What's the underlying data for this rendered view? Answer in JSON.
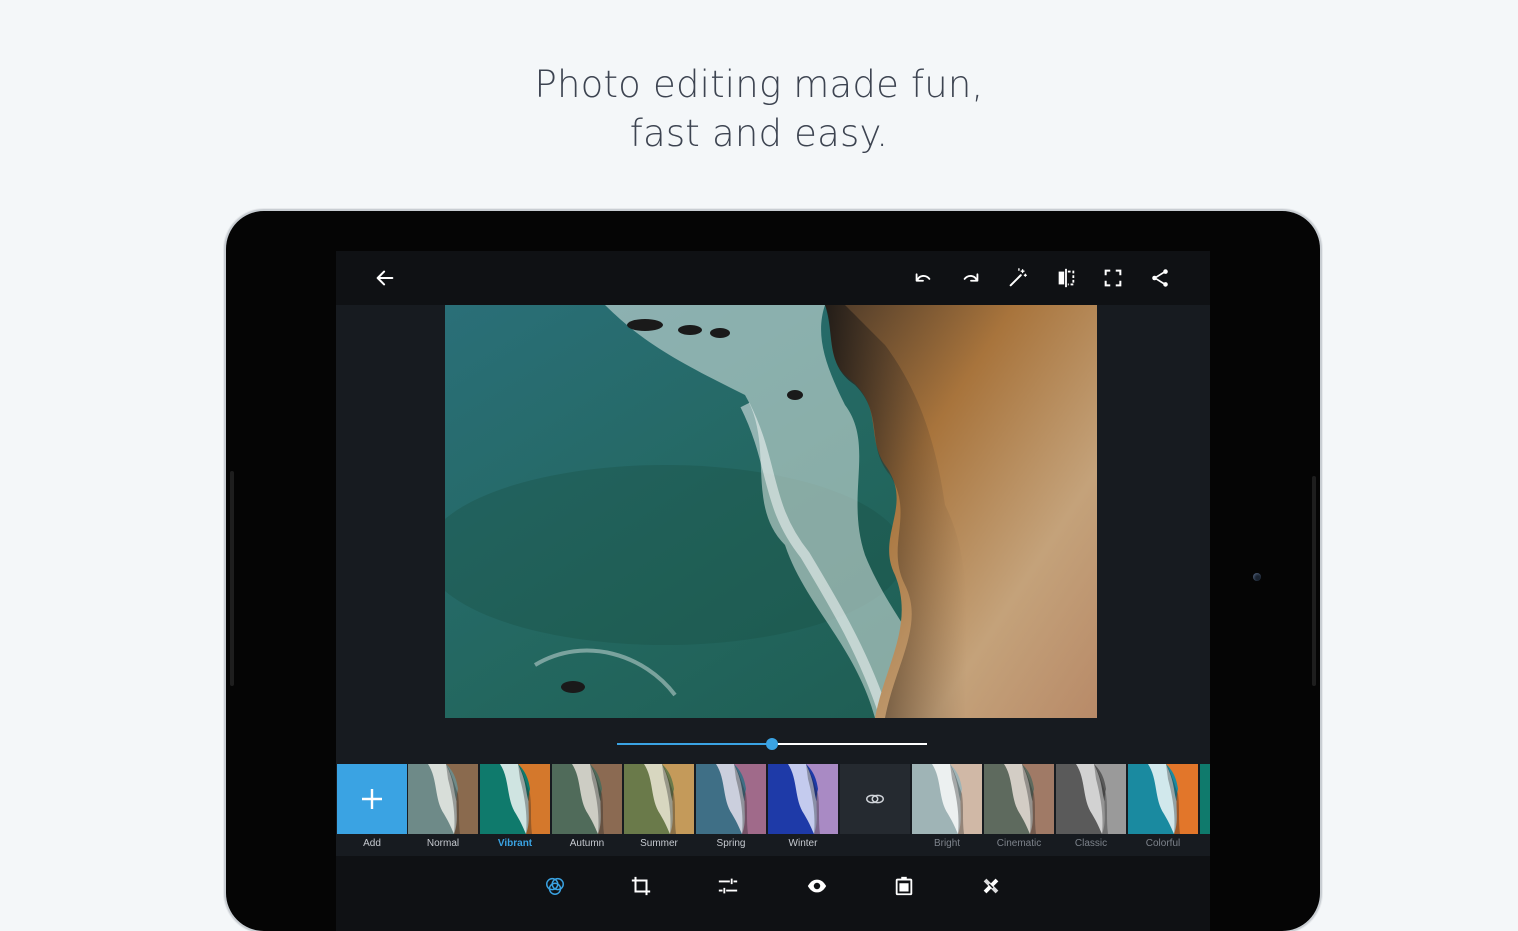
{
  "headline": {
    "line1": "Photo editing made fun,",
    "line2": "fast and easy."
  },
  "toolbar": {
    "left": [
      {
        "name": "back-arrow-icon"
      }
    ],
    "right": [
      {
        "name": "undo-icon"
      },
      {
        "name": "redo-icon"
      },
      {
        "name": "magic-wand-icon"
      },
      {
        "name": "compare-icon"
      },
      {
        "name": "fullscreen-icon"
      },
      {
        "name": "share-icon"
      }
    ]
  },
  "intensity_slider": {
    "value": 0.5
  },
  "filters": {
    "add_label": "Add",
    "items": [
      {
        "label": "Normal",
        "tone": "normal"
      },
      {
        "label": "Vibrant",
        "tone": "vibrant",
        "selected": true
      },
      {
        "label": "Autumn",
        "tone": "autumn"
      },
      {
        "label": "Summer",
        "tone": "summer"
      },
      {
        "label": "Spring",
        "tone": "spring"
      },
      {
        "label": "Winter",
        "tone": "winter"
      }
    ],
    "link_icon": "creative-cloud-link-icon",
    "extra_items": [
      {
        "label": "Bright",
        "tone": "bright"
      },
      {
        "label": "Cinematic",
        "tone": "cinematic"
      },
      {
        "label": "Classic",
        "tone": "classic"
      },
      {
        "label": "Colorful",
        "tone": "colorful"
      }
    ]
  },
  "bottom_tools": [
    {
      "name": "looks-icon",
      "active": true
    },
    {
      "name": "crop-icon"
    },
    {
      "name": "adjustments-icon"
    },
    {
      "name": "red-eye-icon"
    },
    {
      "name": "border-icon"
    },
    {
      "name": "spot-heal-icon"
    }
  ],
  "colors": {
    "accent": "#3aa3e3",
    "headline": "#3d4451",
    "background": "#f4f7f9",
    "screen_dark": "#0f1114"
  }
}
